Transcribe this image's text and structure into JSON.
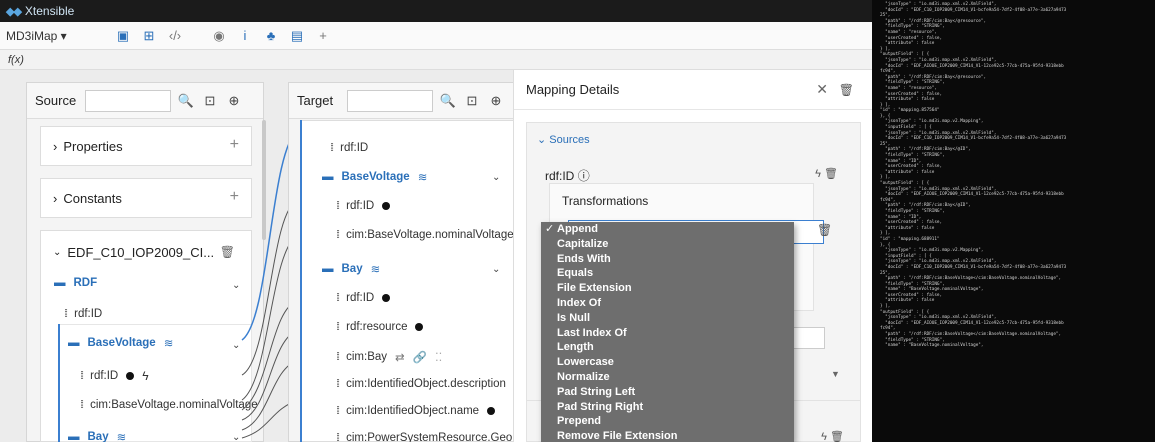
{
  "brand": {
    "name": "Xtensible"
  },
  "toolbar": {
    "app_name": "MD3iMap ▾",
    "fx": "f(x)"
  },
  "source_panel": {
    "title": "Source",
    "properties_label": "Properties",
    "constants_label": "Constants",
    "model_label": "EDF_C10_IOP2009_CI...",
    "tree": {
      "rdf_label": "RDF",
      "rdf_id": "rdf:ID",
      "base_voltage": "BaseVoltage",
      "bv_rdf_id": "rdf:ID",
      "bv_nominal": "cim:BaseVoltage.nominalVoltage",
      "bay": "Bay"
    }
  },
  "target_panel": {
    "title": "Target",
    "tree": {
      "rdf_id": "rdf:ID",
      "base_voltage": "BaseVoltage",
      "bv_rdf_id": "rdf:ID",
      "bv_nominal": "cim:BaseVoltage.nominalVoltage",
      "bay": "Bay",
      "bay_rdf_id": "rdf:ID",
      "bay_resource": "rdf:resource",
      "bay_cim": "cim:Bay",
      "io_description": "cim:IdentifiedObject.description",
      "io_name": "cim:IdentifiedObject.name",
      "psr_geo": "cim:PowerSystemResource.GeoL"
    }
  },
  "mapping_details": {
    "title": "Mapping Details",
    "sources_label": "Sources",
    "source_field": "rdf:ID",
    "transformations_label": "Transformations"
  },
  "dropdown": {
    "options": [
      "Append",
      "Capitalize",
      "Ends With",
      "Equals",
      "File Extension",
      "Index Of",
      "Is Null",
      "Last Index Of",
      "Length",
      "Lowercase",
      "Normalize",
      "Pad String Left",
      "Pad String Right",
      "Prepend",
      "Remove File Extension"
    ],
    "selected": "Append"
  },
  "code_panel": {
    "text": "  \"jsonType\" : \"io.md3i.map.xml.v2.XmlField\",\n  \"docId\" : \"EDF_C10_IOP2009_CIM14_V1-bcfe9a54-7df2-4f08-a77e-3a627a9473\n25\",\n  \"path\" : \"/rdf:RDF/cim:Bay</@resource\",\n  \"fieldType\" : \"STRING\",\n  \"name\" : \"resource\",\n  \"userCreated\" : false,\n  \"attribute\" : false\n} ],\n\"outputField\" : [ {\n  \"jsonType\" : \"io.md3i.map.xml.v2.XmlField\",\n  \"docId\" : \"EDF_AIOUE_IOP2009_CIM14_V1-12ce92c5-77cb-475a-95fd-9318ebb\nfc94\",\n  \"path\" : \"/rdf:RDF/cim:Bay</@resource\",\n  \"fieldType\" : \"STRING\",\n  \"name\" : \"resource\",\n  \"userCreated\" : false,\n  \"attribute\" : false\n} ],\n\"id\" : \"mapping.857564\"\n}, {\n  \"jsonType\" : \"io.md3i.map.v2.Mapping\",\n  \"inputField\" : [ {\n  \"jsonType\" : \"io.md3i.map.xml.v2.XmlField\",\n  \"docId\" : \"EDF_C10_IOP2009_CIM14_V1-bcfe9a54-7df2-4f08-a77e-3a627a9473\n25\",\n  \"path\" : \"/rdf:RDF/cim:Bay</@ID\",\n  \"fieldType\" : \"STRING\",\n  \"name\" : \"ID\",\n  \"userCreated\" : false,\n  \"attribute\" : false\n} ],\n\"outputField\" : [ {\n  \"jsonType\" : \"io.md3i.map.xml.v2.XmlField\",\n  \"docId\" : \"EDF_AIOUE_IOP2009_CIM14_V1-12ce92c5-77cb-475a-95fd-9318ebb\nfc94\",\n  \"path\" : \"/rdf:RDF/cim:Bay</@ID\",\n  \"fieldType\" : \"STRING\",\n  \"name\" : \"ID\",\n  \"userCreated\" : false,\n  \"attribute\" : false\n} ],\n\"id\" : \"mapping.688911\"\n}, {\n  \"jsonType\" : \"io.md3i.map.v2.Mapping\",\n  \"inputField\" : [ {\n  \"jsonType\" : \"io.md3i.map.xml.v2.XmlField\",\n  \"docId\" : \"EDF_C10_IOP2009_CIM14_V1-bcfe9a54-7df2-4f08-a77e-3a627a9473\n25\",\n  \"path\" : \"/rdf:RDF/cim:BaseVoltage</cim:BaseVoltage.nominalVoltage\",\n  \"fieldType\" : \"STRING\",\n  \"name\" : \"BaseVoltage.nominalVoltage\",\n  \"userCreated\" : false,\n  \"attribute\" : false\n} ],\n\"outputField\" : [ {\n  \"jsonType\" : \"io.md3i.map.xml.v2.XmlField\",\n  \"docId\" : \"EDF_AIOUE_IOP2009_CIM14_V1-12ce92c5-77cb-475a-95fd-9318ebb\nfc94\",\n  \"path\" : \"/rdf:RDF/cim:BaseVoltage</cim:BaseVoltage.nominalVoltage\",\n  \"fieldType\" : \"STRING\",\n  \"name\" : \"BaseVoltage.nominalVoltage\","
  }
}
